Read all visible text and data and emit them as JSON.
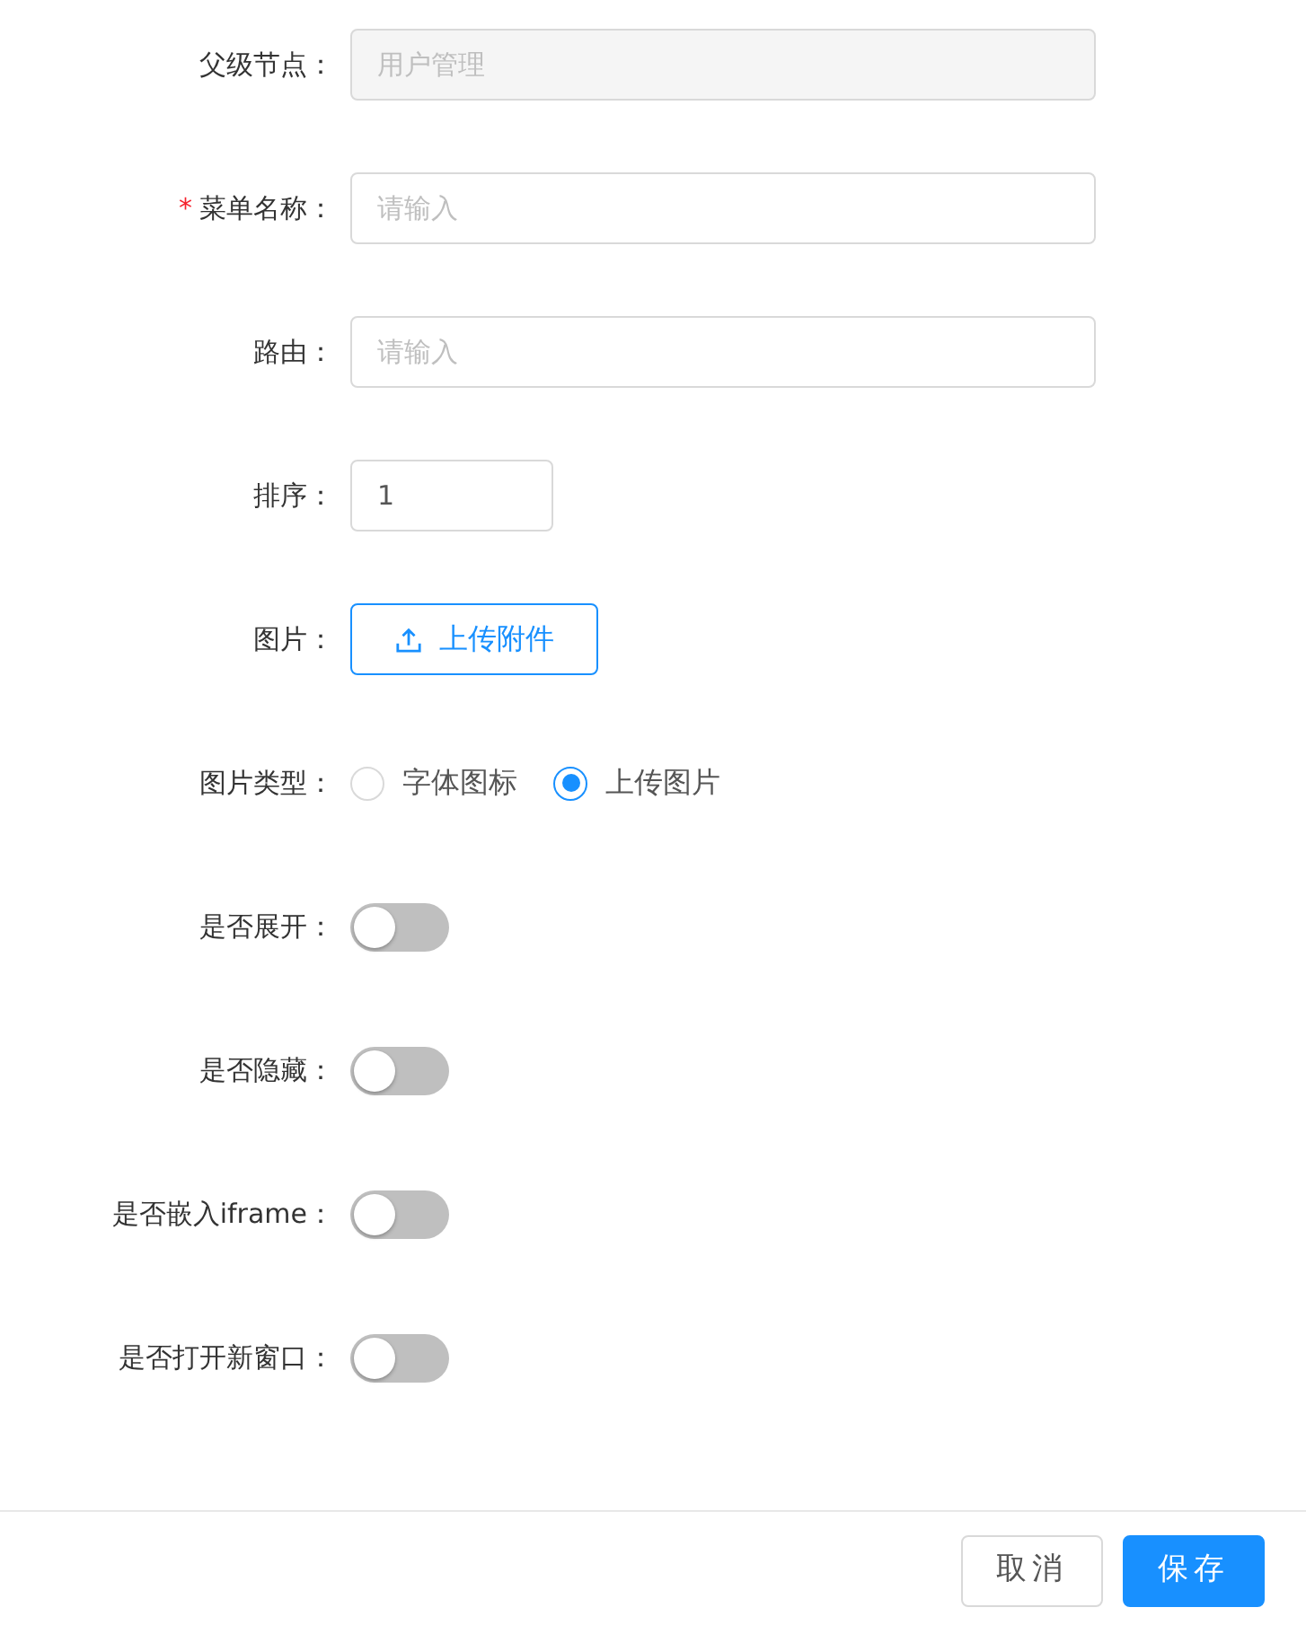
{
  "fields": [
    {
      "kind": "text",
      "label": "父级节点：",
      "required": false,
      "disabled": true,
      "value": "用户管理"
    },
    {
      "kind": "text",
      "label": "菜单名称：",
      "required": true,
      "placeholder": "请输入"
    },
    {
      "kind": "text",
      "label": "路由：",
      "required": false,
      "placeholder": "请输入"
    },
    {
      "kind": "number",
      "label": "排序：",
      "required": false,
      "value": "1"
    },
    {
      "kind": "upload",
      "label": "图片：",
      "required": false,
      "button": "上传附件"
    },
    {
      "kind": "radio",
      "label": "图片类型：",
      "required": false,
      "options": [
        {
          "label": "字体图标",
          "selected": false
        },
        {
          "label": "上传图片",
          "selected": true
        }
      ]
    },
    {
      "kind": "switch",
      "label": "是否展开：",
      "required": false,
      "on": false
    },
    {
      "kind": "switch",
      "label": "是否隐藏：",
      "required": false,
      "on": false
    },
    {
      "kind": "switch",
      "label": "是否嵌入iframe：",
      "required": false,
      "on": false
    },
    {
      "kind": "switch",
      "label": "是否打开新窗口：",
      "required": false,
      "on": false
    }
  ],
  "required_mark": "*",
  "footer": {
    "buttons": [
      {
        "label": "取消",
        "kind": "default"
      },
      {
        "label": "保存",
        "kind": "primary"
      }
    ]
  }
}
